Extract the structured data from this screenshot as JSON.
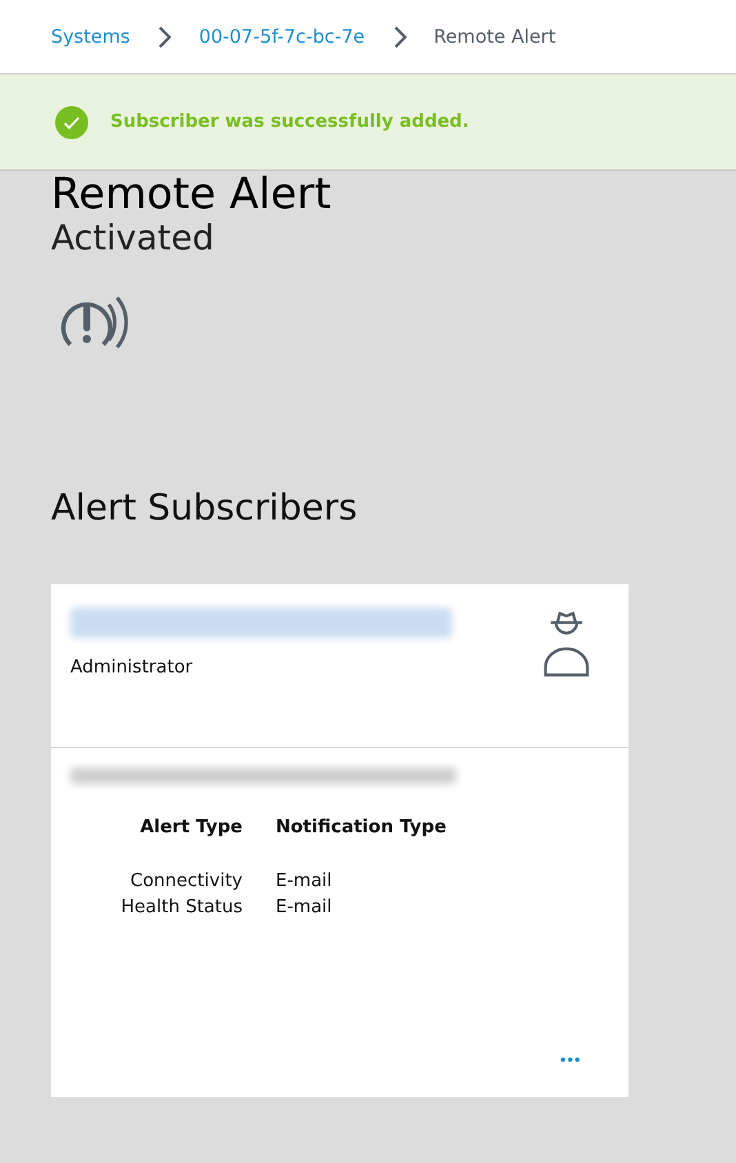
{
  "breadcrumbs": [
    {
      "label": "Systems",
      "link": true
    },
    {
      "label": "00-07-5f-7c-bc-7e",
      "link": true
    },
    {
      "label": "Remote Alert",
      "link": false
    }
  ],
  "banner": {
    "kind": "success",
    "message": "Subscriber was successfully added."
  },
  "feature": {
    "title": "Remote Alert",
    "status": "Activated"
  },
  "section_title": "Alert Subscribers",
  "subscriber": {
    "role": "Administrator",
    "columns": [
      "Alert Type",
      "Notification Type"
    ],
    "rows": [
      [
        "Connectivity",
        "E-mail"
      ],
      [
        "Health Status",
        "E-mail"
      ]
    ],
    "menu": "•••"
  }
}
